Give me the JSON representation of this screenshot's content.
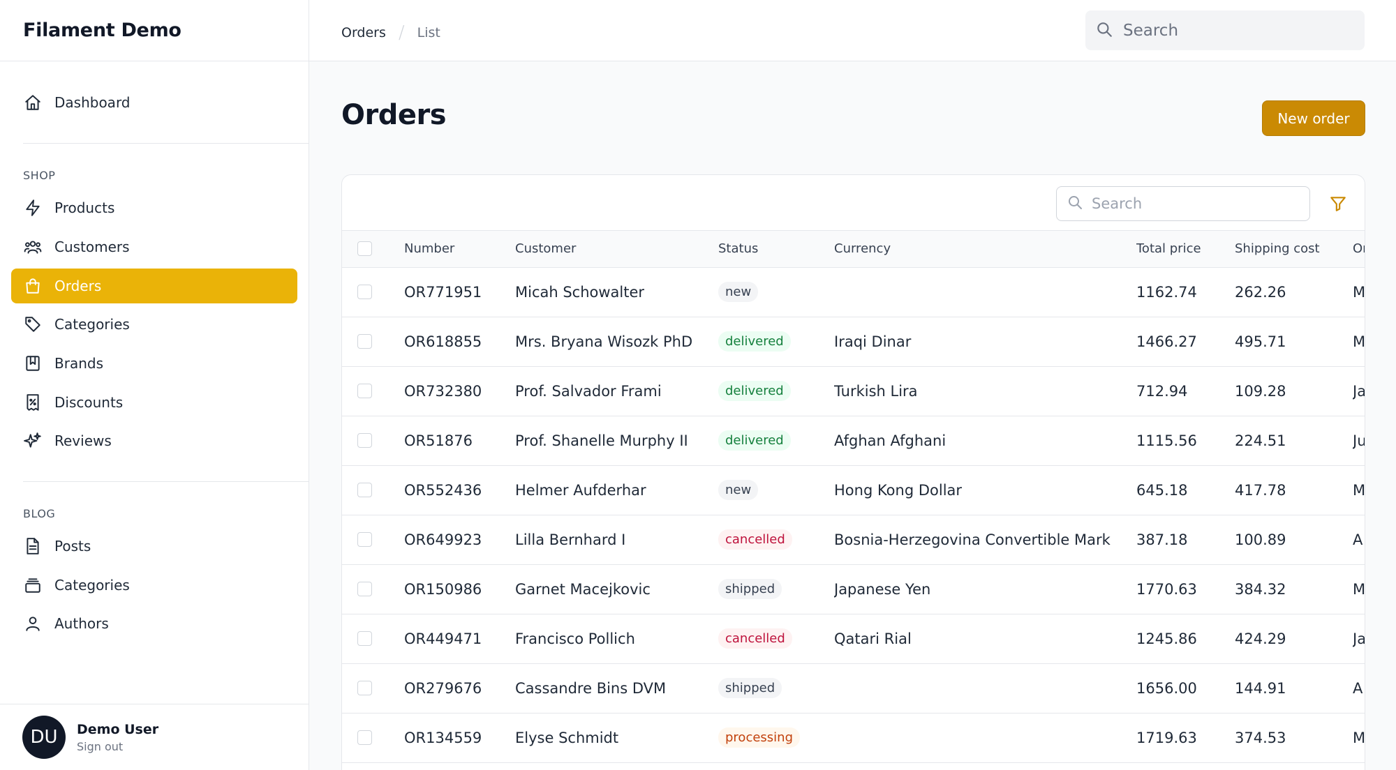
{
  "app": {
    "title": "Filament Demo"
  },
  "nav": {
    "dashboard": "Dashboard",
    "shop_label": "SHOP",
    "shop_items": [
      "Products",
      "Customers",
      "Orders",
      "Categories",
      "Brands",
      "Discounts",
      "Reviews"
    ],
    "active_item": "Orders",
    "blog_label": "BLOG",
    "blog_items": [
      "Posts",
      "Categories",
      "Authors"
    ]
  },
  "user": {
    "initials": "DU",
    "name": "Demo User",
    "sign_out": "Sign out"
  },
  "breadcrumb": {
    "root": "Orders",
    "current": "List"
  },
  "global_search": {
    "placeholder": "Search"
  },
  "page": {
    "title": "Orders",
    "new_button": "New order"
  },
  "table": {
    "search_placeholder": "Search",
    "columns": [
      "Number",
      "Customer",
      "Status",
      "Currency",
      "Total price",
      "Shipping cost",
      "Or"
    ],
    "rows": [
      {
        "number": "OR771951",
        "customer": "Micah Schowalter",
        "status": "new",
        "currency": "",
        "total": "1162.74",
        "shipping": "262.26",
        "extra": "M"
      },
      {
        "number": "OR618855",
        "customer": "Mrs. Bryana Wisozk PhD",
        "status": "delivered",
        "currency": "Iraqi Dinar",
        "total": "1466.27",
        "shipping": "495.71",
        "extra": "M"
      },
      {
        "number": "OR732380",
        "customer": "Prof. Salvador Frami",
        "status": "delivered",
        "currency": "Turkish Lira",
        "total": "712.94",
        "shipping": "109.28",
        "extra": "Ja"
      },
      {
        "number": "OR51876",
        "customer": "Prof. Shanelle Murphy II",
        "status": "delivered",
        "currency": "Afghan Afghani",
        "total": "1115.56",
        "shipping": "224.51",
        "extra": "Ju"
      },
      {
        "number": "OR552436",
        "customer": "Helmer Aufderhar",
        "status": "new",
        "currency": "Hong Kong Dollar",
        "total": "645.18",
        "shipping": "417.78",
        "extra": "M"
      },
      {
        "number": "OR649923",
        "customer": "Lilla Bernhard I",
        "status": "cancelled",
        "currency": "Bosnia-Herzegovina Convertible Mark",
        "total": "387.18",
        "shipping": "100.89",
        "extra": "A"
      },
      {
        "number": "OR150986",
        "customer": "Garnet Macejkovic",
        "status": "shipped",
        "currency": "Japanese Yen",
        "total": "1770.63",
        "shipping": "384.32",
        "extra": "M"
      },
      {
        "number": "OR449471",
        "customer": "Francisco Pollich",
        "status": "cancelled",
        "currency": "Qatari Rial",
        "total": "1245.86",
        "shipping": "424.29",
        "extra": "Ja"
      },
      {
        "number": "OR279676",
        "customer": "Cassandre Bins DVM",
        "status": "shipped",
        "currency": "",
        "total": "1656.00",
        "shipping": "144.91",
        "extra": "A"
      },
      {
        "number": "OR134559",
        "customer": "Elyse Schmidt",
        "status": "processing",
        "currency": "",
        "total": "1719.63",
        "shipping": "374.53",
        "extra": "M"
      }
    ]
  },
  "colors": {
    "accent": "#eab308",
    "button": "#ca8a04"
  }
}
